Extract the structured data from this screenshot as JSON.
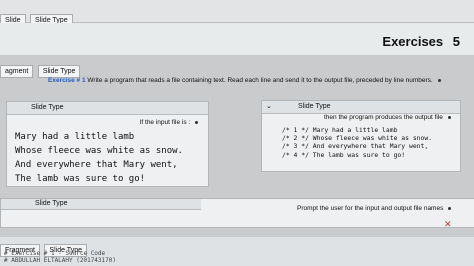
{
  "tabs": [
    {
      "label": "Slide"
    },
    {
      "label": "Slide Type"
    }
  ],
  "header": {
    "title": "Exercises",
    "number": "5"
  },
  "fragment_tag": {
    "label_a": "agment",
    "label_b": "Slide Type"
  },
  "exercise": {
    "label": "Exercise # 1",
    "text": "Write a program that reads a file containing text. Read each line and send it to the output file, preceded by line numbers."
  },
  "left_panel": {
    "slide_type": "Slide Type",
    "caption": "If the input file is :",
    "lines": [
      "Mary had a little lamb",
      "Whose fleece was white as snow.",
      "And everywhere that Mary went,",
      "The lamb was sure to go!"
    ]
  },
  "right_panel": {
    "slide_type": "Slide Type",
    "caption": "then the program produces the output file",
    "lines": [
      "/* 1 */ Mary had a little lamb",
      "/* 2 */ Whose fleece was white as snow.",
      "/* 3 */ And everywhere that Mary went,",
      "/* 4 */ The lamb was sure to go!"
    ]
  },
  "prompt_panel": {
    "slide_type": "Slide Type",
    "text": "Prompt the user for the input and output file names"
  },
  "bottom": {
    "fragment": "Fragment",
    "slide_type": "Slide Type",
    "line1": "# Exercise # 1 - Source Code",
    "line2": "# ABDULLAH ELTALAHY (201743170)"
  },
  "colors": {
    "accent": "#1f5fbf",
    "background": "#c9cbcc"
  },
  "icons": [
    "chevron-down-icon",
    "bullet-icon",
    "close-icon"
  ]
}
